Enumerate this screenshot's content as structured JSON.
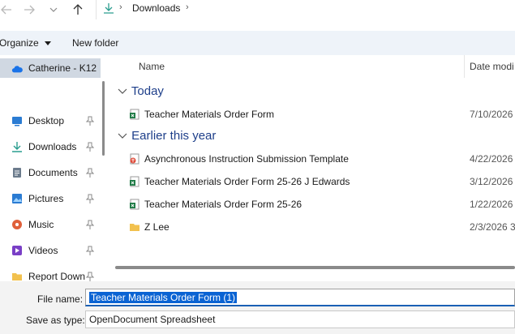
{
  "address_bar": {
    "back_icon": "back-arrow-icon",
    "forward_icon": "forward-arrow-icon",
    "recent_icon": "chevron-down-icon",
    "up_icon": "up-arrow-icon",
    "location_icon": "download-icon",
    "path": [
      "Downloads"
    ]
  },
  "toolbar": {
    "organize_label": "Organize",
    "new_folder_label": "New folder"
  },
  "navigation": {
    "onedrive_label": "Catherine - K12",
    "items": [
      {
        "label": "Desktop",
        "icon": "desktop-icon",
        "color": "#2b7cd3"
      },
      {
        "label": "Downloads",
        "icon": "download-icon",
        "color": "#2a9d8f"
      },
      {
        "label": "Documents",
        "icon": "document-icon",
        "color": "#6b7b8c"
      },
      {
        "label": "Pictures",
        "icon": "pictures-icon",
        "color": "#2b7cd3"
      },
      {
        "label": "Music",
        "icon": "music-icon",
        "color": "#e0603a"
      },
      {
        "label": "Videos",
        "icon": "videos-icon",
        "color": "#7a3fc6"
      },
      {
        "label": "Report Down",
        "icon": "folder-icon",
        "color": "#f2c14e"
      }
    ]
  },
  "file_list": {
    "columns": {
      "name": "Name",
      "date": "Date modi"
    },
    "groups": [
      {
        "label": "Today"
      },
      {
        "label": "Earlier this year"
      }
    ],
    "rows": [
      {
        "name": "Teacher Materials Order Form",
        "date": "7/10/2026",
        "icon": "spreadsheet-icon"
      },
      {
        "name": "Asynchronous Instruction Submission Template",
        "date": "4/22/2026",
        "icon": "web-document-icon"
      },
      {
        "name": "Teacher Materials Order Form 25-26 J Edwards",
        "date": "3/12/2026",
        "icon": "spreadsheet-icon"
      },
      {
        "name": "Teacher Materials Order Form 25-26",
        "date": "1/22/2026",
        "icon": "spreadsheet-icon"
      },
      {
        "name": "Z Lee",
        "date": "2/3/2026 3",
        "icon": "folder-icon"
      }
    ]
  },
  "save_form": {
    "file_name_label": "File name:",
    "file_name_value": "Teacher Materials Order Form (1)",
    "save_type_label": "Save as type:",
    "save_type_value": "OpenDocument Spreadsheet"
  },
  "colors": {
    "accent": "#0a63d3",
    "group_header": "#1e3f8a",
    "toolbar_bg": "#eef3f9",
    "spreadsheet_green": "#1e7a45"
  }
}
